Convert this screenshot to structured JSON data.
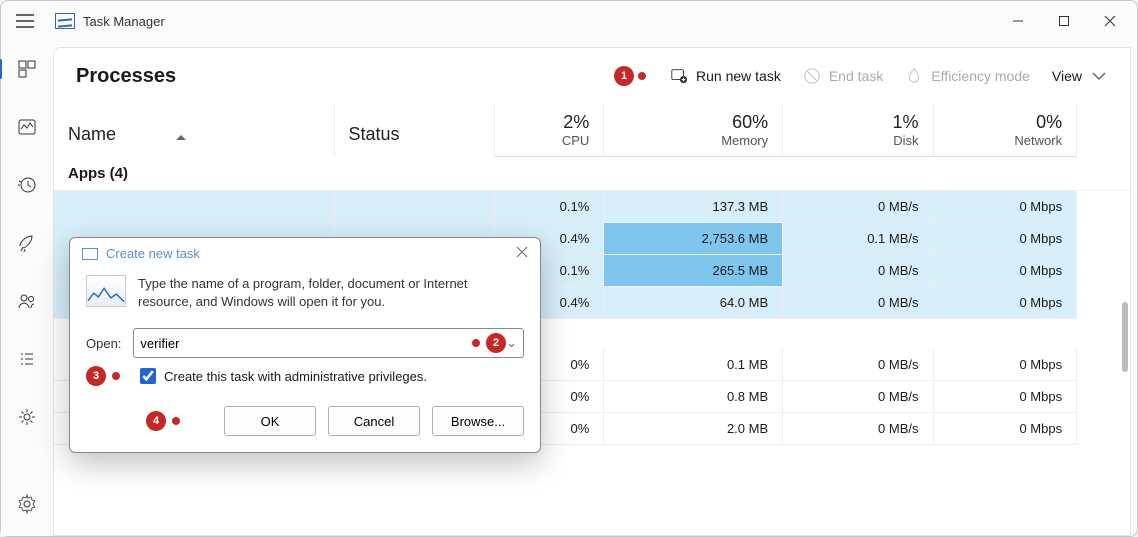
{
  "app": {
    "title": "Task Manager"
  },
  "header": {
    "title": "Processes",
    "run_new_task": "Run new task",
    "end_task": "End task",
    "efficiency": "Efficiency mode",
    "view": "View"
  },
  "columns": {
    "name": "Name",
    "status": "Status",
    "cpu": "CPU",
    "cpu_pct": "2%",
    "memory": "Memory",
    "memory_pct": "60%",
    "disk": "Disk",
    "disk_pct": "1%",
    "network": "Network",
    "network_pct": "0%"
  },
  "groups": {
    "apps": "Apps (4)"
  },
  "rows": [
    {
      "cpu": "0.1%",
      "mem": "137.3 MB",
      "disk": "0 MB/s",
      "net": "0 Mbps",
      "memsel": false
    },
    {
      "cpu": "0.4%",
      "mem": "2,753.6 MB",
      "disk": "0.1 MB/s",
      "net": "0 Mbps",
      "memsel": true
    },
    {
      "cpu": "0.1%",
      "mem": "265.5 MB",
      "disk": "0 MB/s",
      "net": "0 Mbps",
      "memsel": true
    },
    {
      "cpu": "0.4%",
      "mem": "64.0 MB",
      "disk": "0 MB/s",
      "net": "0 Mbps",
      "memsel": false
    }
  ],
  "bg_rows": [
    {
      "cpu": "0%",
      "mem": "0.1 MB",
      "disk": "0 MB/s",
      "net": "0 Mbps"
    },
    {
      "cpu": "0%",
      "mem": "0.8 MB",
      "disk": "0 MB/s",
      "net": "0 Mbps"
    },
    {
      "cpu": "0%",
      "mem": "2.0 MB",
      "disk": "0 MB/s",
      "net": "0 Mbps"
    }
  ],
  "dialog": {
    "title": "Create new task",
    "desc": "Type the name of a program, folder, document or Internet resource, and Windows will open it for you.",
    "open_label": "Open:",
    "open_value": "verifier",
    "admin_label": "Create this task with administrative privileges.",
    "ok": "OK",
    "cancel": "Cancel",
    "browse": "Browse..."
  },
  "annotations": {
    "a1": "1",
    "a2": "2",
    "a3": "3",
    "a4": "4"
  }
}
